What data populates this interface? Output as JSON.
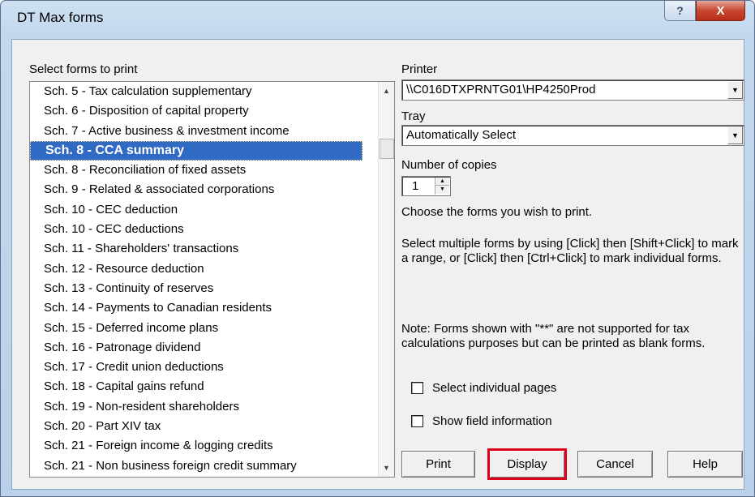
{
  "window": {
    "title": "DT Max forms",
    "help_glyph": "?",
    "close_glyph": "X"
  },
  "forms": {
    "label": "Select forms to print",
    "items": [
      "Sch. 5 - Tax calculation supplementary",
      "Sch. 6 - Disposition of capital property",
      "Sch. 7 - Active business & investment income",
      "Sch. 8 - CCA summary",
      "Sch. 8 - Reconciliation of fixed assets",
      "Sch. 9 - Related & associated corporations",
      "Sch. 10 - CEC deduction",
      "Sch. 10 - CEC deductions",
      "Sch. 11 - Shareholders' transactions",
      "Sch. 12 - Resource deduction",
      "Sch. 13 - Continuity of reserves",
      "Sch. 14 - Payments to Canadian residents",
      "Sch. 15 - Deferred income plans",
      "Sch. 16 - Patronage dividend",
      "Sch. 17 - Credit union deductions",
      "Sch. 18 - Capital gains refund",
      "Sch. 19 - Non-resident shareholders",
      "Sch. 20 - Part XIV tax",
      "Sch. 21 - Foreign income & logging credits",
      "Sch. 21 - Non business foreign credit summary"
    ],
    "selected": "Sch. 8 - CCA summary"
  },
  "printer": {
    "label": "Printer",
    "value": "\\\\C016DTXPRNTG01\\HP4250Prod"
  },
  "tray": {
    "label": "Tray",
    "value": "Automatically Select"
  },
  "copies": {
    "label": "Number of copies",
    "value": "1"
  },
  "instructions": {
    "choose": "Choose the forms you wish to print.",
    "multi": "Select multiple forms by using [Click] then [Shift+Click] to mark a range, or [Click] then [Ctrl+Click] to mark individual forms.",
    "note": "Note: Forms shown with \"**\" are not supported for tax calculations purposes but can be printed as blank forms."
  },
  "options": {
    "select_pages": "Select individual pages",
    "show_field_info": "Show field information"
  },
  "buttons": {
    "print": "Print",
    "display": "Display",
    "cancel": "Cancel",
    "help": "Help"
  },
  "colors": {
    "selection": "#316ac5",
    "highlight_border": "#e0001b",
    "close_button": "#c7472f"
  }
}
